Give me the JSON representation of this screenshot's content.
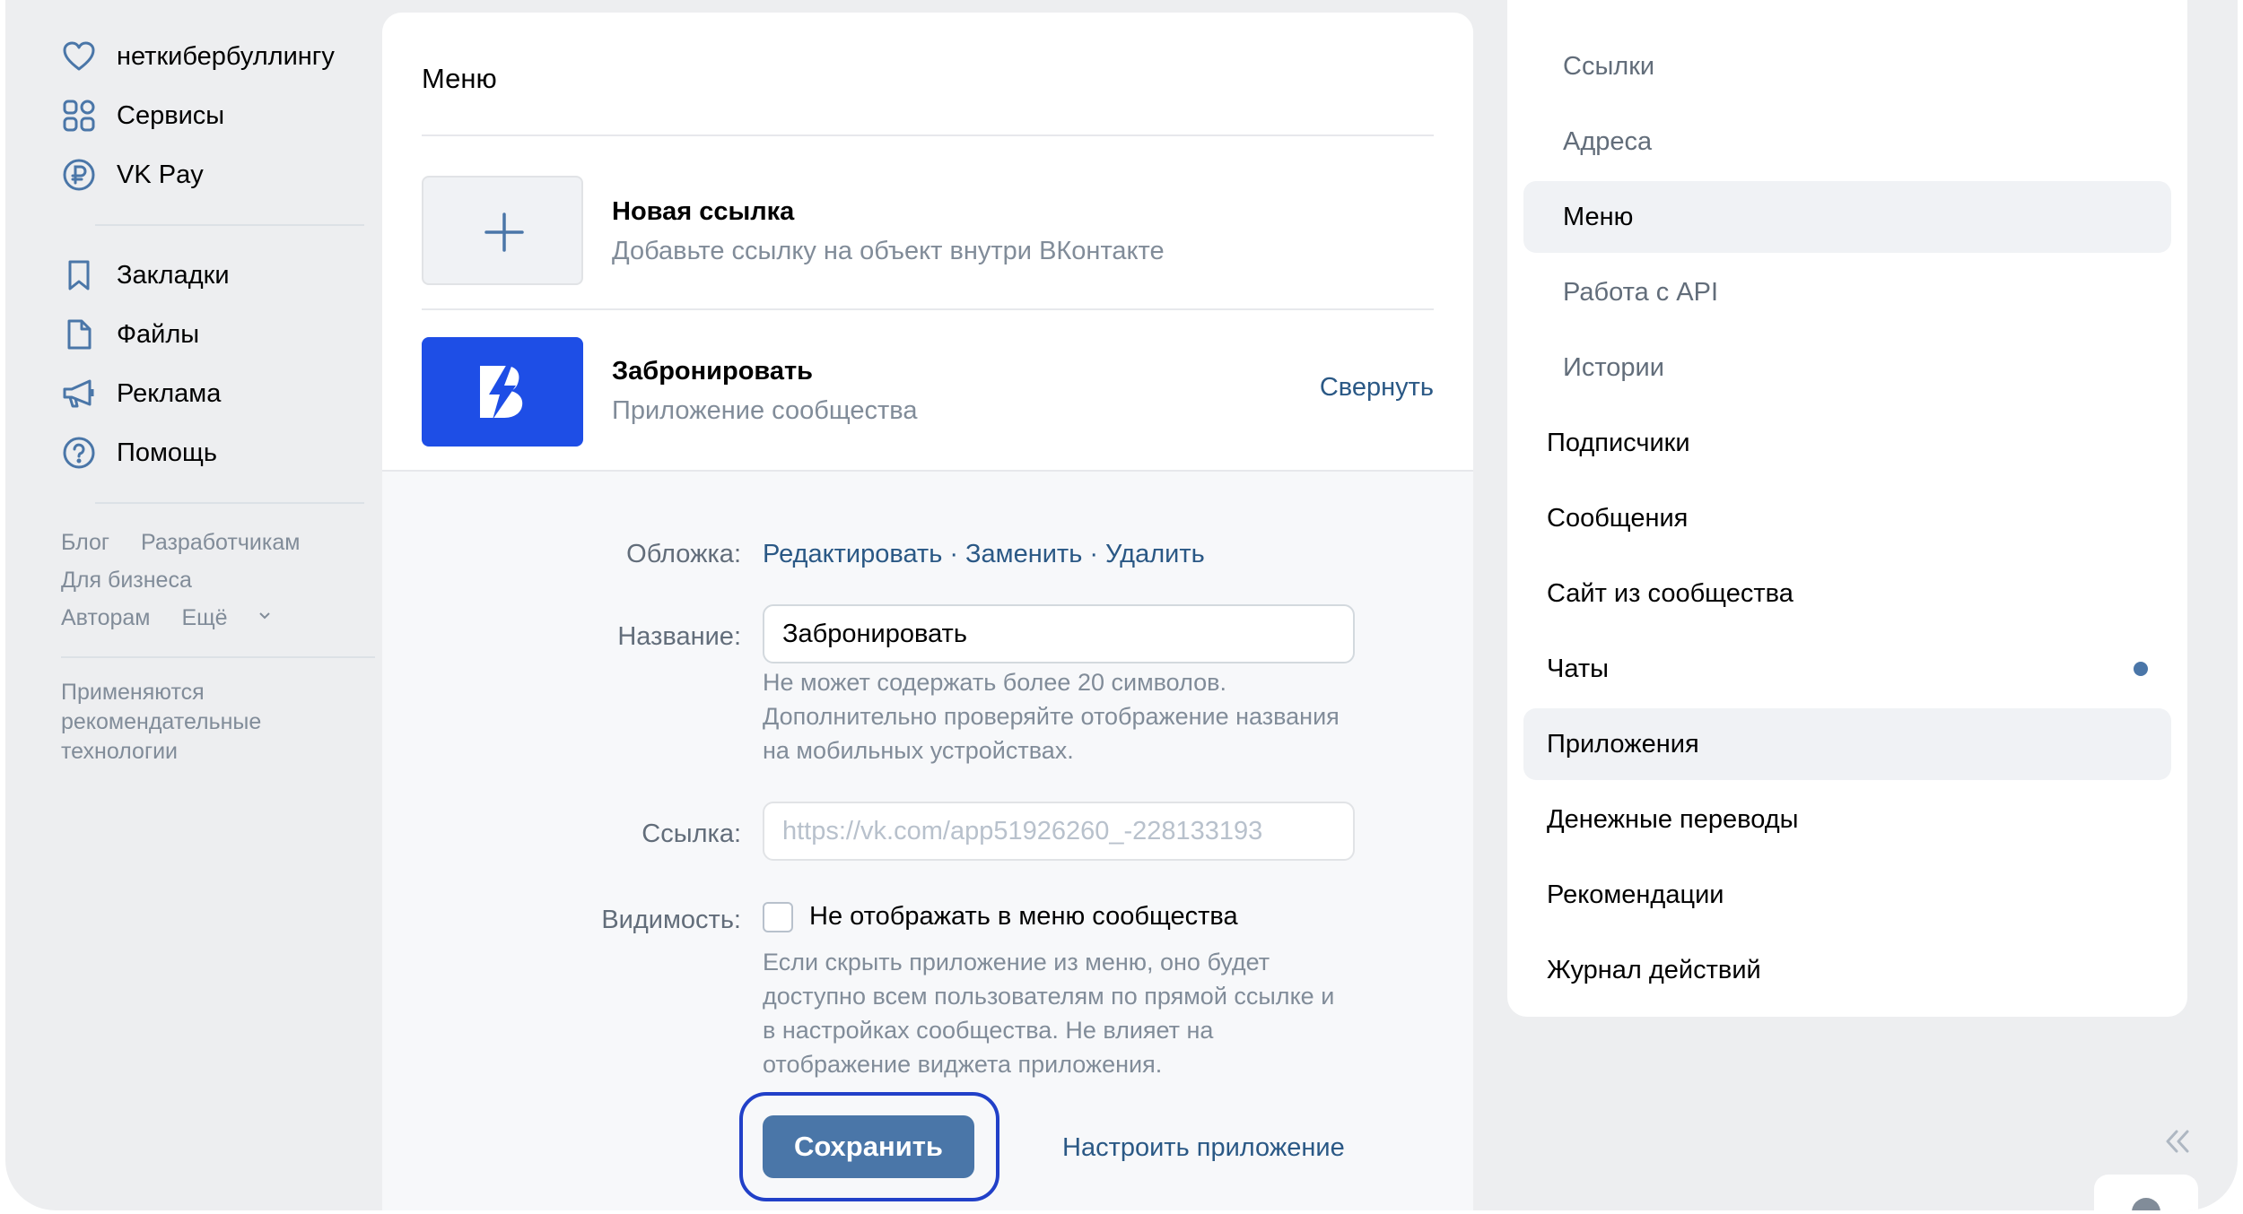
{
  "sidebar": {
    "items": [
      {
        "label": "неткибербуллингу",
        "icon": "heart-icon"
      },
      {
        "label": "Сервисы",
        "icon": "services-icon"
      },
      {
        "label": "VK Pay",
        "icon": "ruble-icon"
      },
      {
        "label": "Закладки",
        "icon": "bookmark-icon"
      },
      {
        "label": "Файлы",
        "icon": "file-icon"
      },
      {
        "label": "Реклама",
        "icon": "megaphone-icon"
      },
      {
        "label": "Помощь",
        "icon": "help-icon"
      }
    ],
    "footer": {
      "blog": "Блог",
      "developers": "Разработчикам",
      "business": "Для бизнеса",
      "authors": "Авторам",
      "more": "Ещё"
    },
    "recommendation_note": "Применяются рекомендательные технологии"
  },
  "main": {
    "title": "Меню",
    "new_link": {
      "title": "Новая ссылка",
      "subtitle": "Добавьте ссылку на объект внутри ВКонтакте"
    },
    "app": {
      "title": "Забронировать",
      "subtitle": "Приложение сообщества",
      "collapse_label": "Свернуть",
      "brand_color": "#1e4ee6"
    },
    "settings": {
      "cover_label": "Обложка:",
      "cover_edit": "Редактировать",
      "cover_replace": "Заменить",
      "cover_delete": "Удалить",
      "name_label": "Название:",
      "name_value": "Забронировать",
      "name_hint": "Не может содержать более 20 символов. Дополнительно проверяйте отображение названия на мобильных устройствах.",
      "link_label": "Ссылка:",
      "link_value": "https://vk.com/app51926260_-228133193",
      "visibility_label": "Видимость:",
      "visibility_checkbox": "Не отображать в меню сообщества",
      "visibility_checked": false,
      "visibility_hint": "Если скрыть приложение из меню, оно будет доступно всем пользователям по прямой ссылке и в настройках сообщества. Не влияет на отображение виджета приложения.",
      "save_label": "Сохранить",
      "configure_label": "Настроить приложение"
    }
  },
  "right_menu": {
    "items": [
      {
        "label": "Ссылки",
        "level": "sub",
        "active": false
      },
      {
        "label": "Адреса",
        "level": "sub",
        "active": false
      },
      {
        "label": "Меню",
        "level": "sub",
        "active": true
      },
      {
        "label": "Работа с API",
        "level": "sub",
        "active": false
      },
      {
        "label": "Истории",
        "level": "sub",
        "active": false
      },
      {
        "label": "Подписчики",
        "level": "top",
        "active": false
      },
      {
        "label": "Сообщения",
        "level": "top",
        "active": false
      },
      {
        "label": "Сайт из сообщества",
        "level": "top",
        "active": false
      },
      {
        "label": "Чаты",
        "level": "top",
        "active": false,
        "indicator": true
      },
      {
        "label": "Приложения",
        "level": "top",
        "active": true
      },
      {
        "label": "Денежные переводы",
        "level": "top",
        "active": false
      },
      {
        "label": "Рекомендации",
        "level": "top",
        "active": false
      },
      {
        "label": "Журнал действий",
        "level": "top",
        "active": false
      }
    ]
  },
  "colors": {
    "accent": "#4a76a8",
    "link": "#2a5885",
    "highlight_ring": "#2140c8",
    "background": "#edeef0"
  }
}
